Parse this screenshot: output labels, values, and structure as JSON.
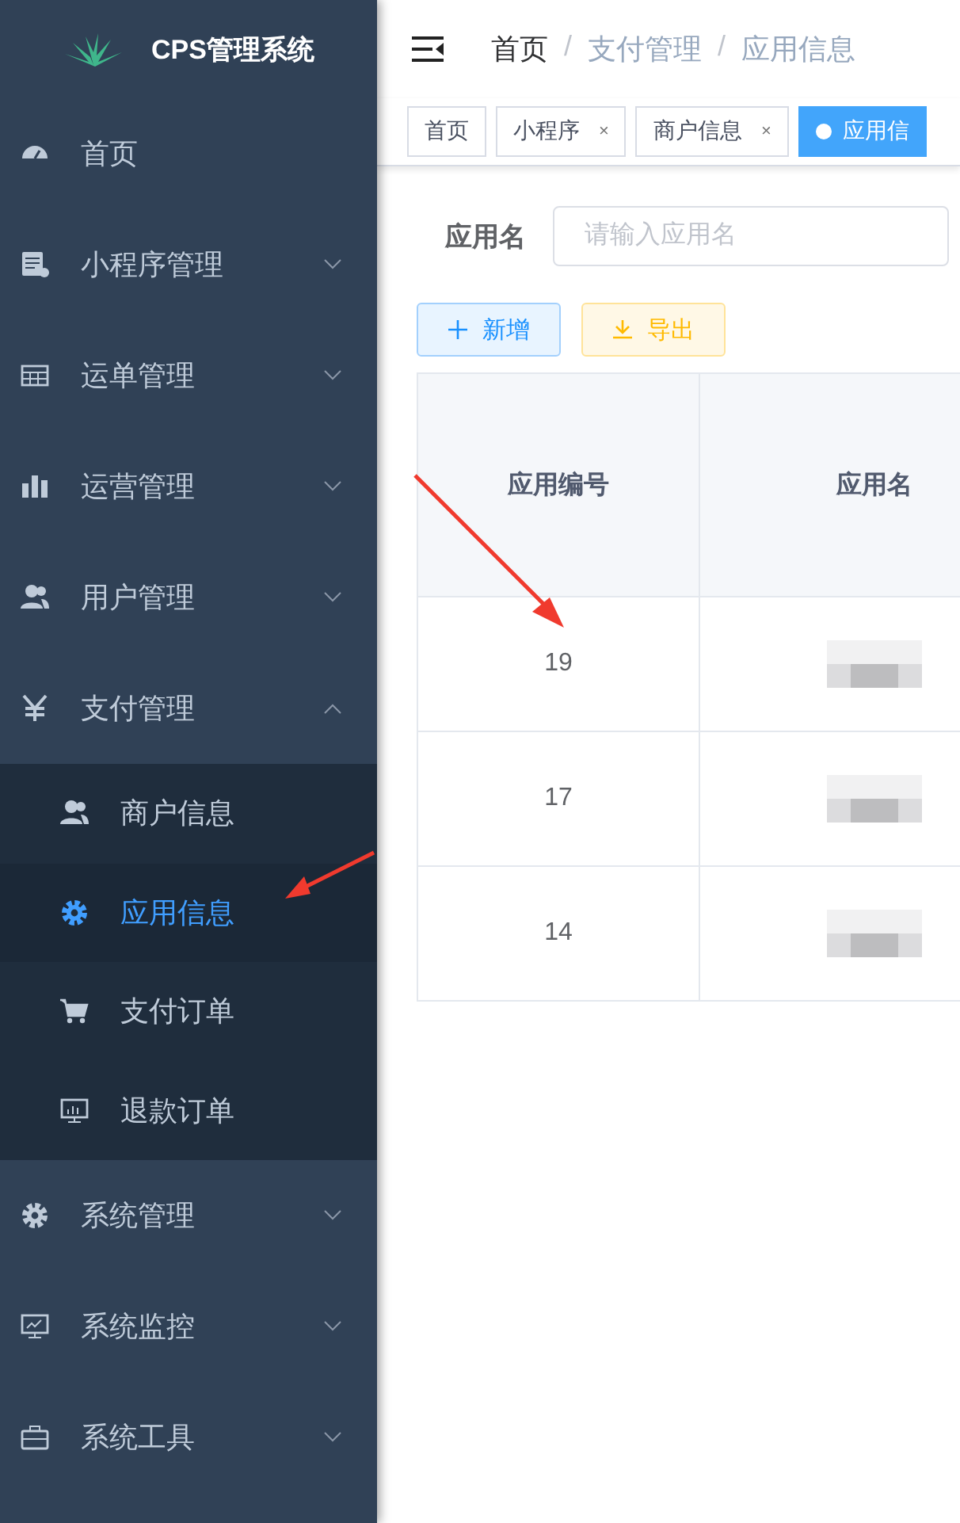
{
  "sidebar": {
    "title": "CPS管理系统",
    "items": [
      {
        "label": "首页"
      },
      {
        "label": "小程序管理",
        "expanded": false
      },
      {
        "label": "运单管理",
        "expanded": false
      },
      {
        "label": "运营管理",
        "expanded": false
      },
      {
        "label": "用户管理",
        "expanded": false
      },
      {
        "label": "支付管理",
        "expanded": true,
        "children": [
          {
            "label": "商户信息",
            "selected": false
          },
          {
            "label": "应用信息",
            "selected": true
          },
          {
            "label": "支付订单",
            "selected": false
          },
          {
            "label": "退款订单",
            "selected": false
          }
        ]
      },
      {
        "label": "系统管理",
        "expanded": false
      },
      {
        "label": "系统监控",
        "expanded": false
      },
      {
        "label": "系统工具",
        "expanded": false
      }
    ]
  },
  "breadcrumb": {
    "separator": "/",
    "items": [
      "首页",
      "支付管理",
      "应用信息"
    ]
  },
  "tabs": [
    {
      "label": "首页",
      "selected": false
    },
    {
      "label": "小程序",
      "close": "×",
      "selected": false
    },
    {
      "label": "商户信息",
      "close": "×",
      "selected": false
    },
    {
      "label": "应用信",
      "selected": true
    }
  ],
  "search": {
    "label": "应用名",
    "placeholder": "请输入应用名"
  },
  "buttons": [
    {
      "label": "新增",
      "kind": "add"
    },
    {
      "label": "导出",
      "kind": "export"
    }
  ],
  "table": {
    "columns": [
      "应用编号",
      "应用名"
    ],
    "rows": [
      [
        "19"
      ],
      [
        "17"
      ],
      [
        "14"
      ]
    ]
  }
}
